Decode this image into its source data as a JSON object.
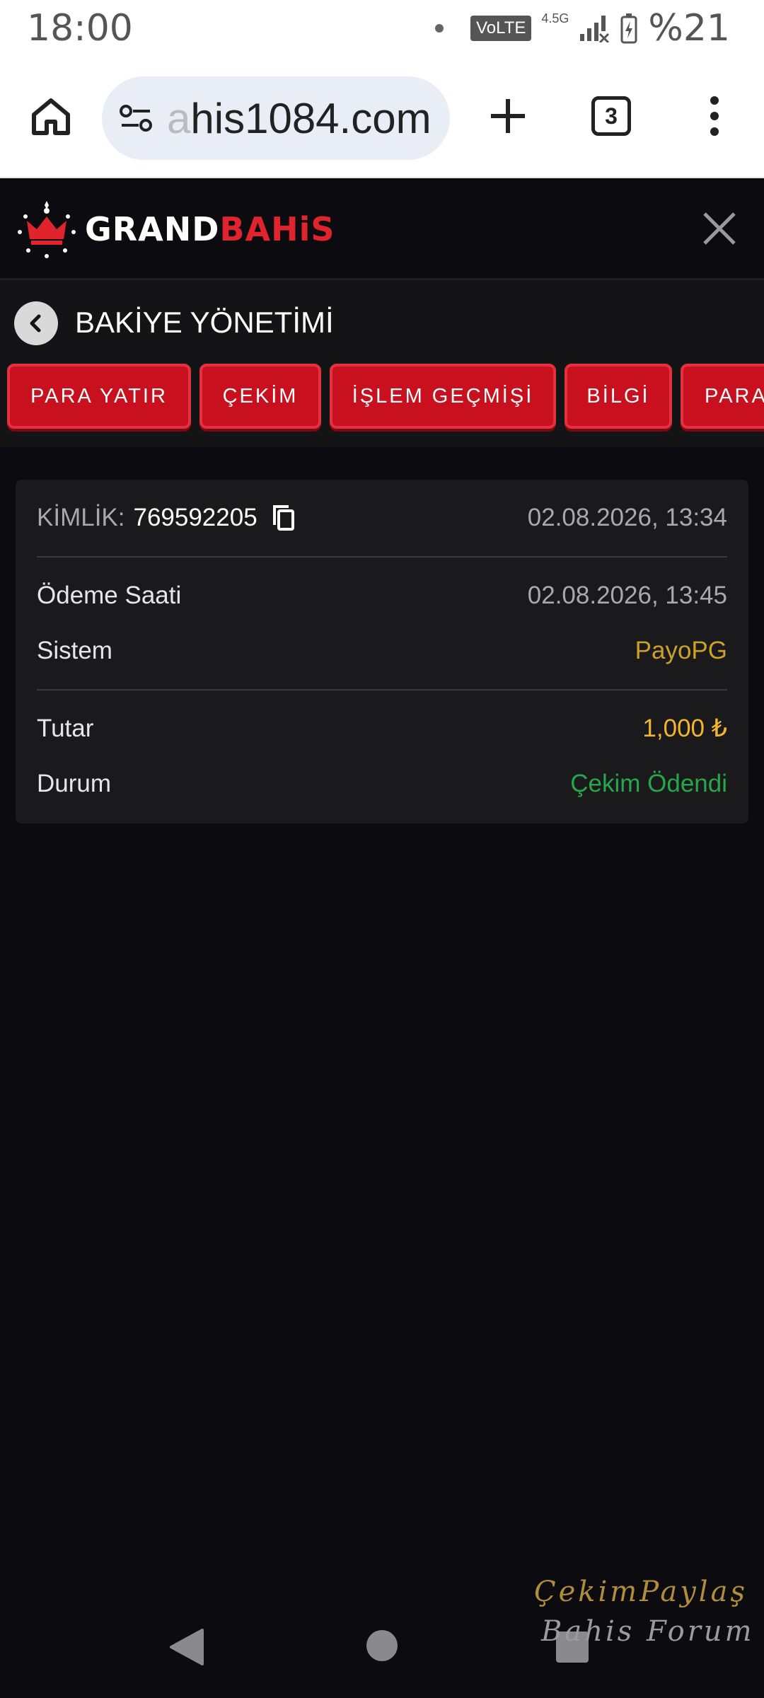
{
  "status": {
    "time": "18:00",
    "volte": "VoLTE",
    "network": "4.5G",
    "battery": "%21"
  },
  "browser": {
    "url_faded": "a",
    "url": "his1084.com",
    "tab_count": "3"
  },
  "header": {
    "logo_grand": "GRAND",
    "logo_bahis": "BAHiS"
  },
  "page": {
    "title": "BAKİYE YÖNETİMİ",
    "tabs": [
      {
        "label": "PARA YATIR"
      },
      {
        "label": "ÇEKİM"
      },
      {
        "label": "İŞLEM GEÇMİŞİ"
      },
      {
        "label": "BİLGİ"
      },
      {
        "label": "PARA"
      }
    ]
  },
  "transaction": {
    "id_label": "KİMLİK:",
    "id_value": "769592205",
    "created": "02.08.2026, 13:34",
    "payment_time_label": "Ödeme Saati",
    "payment_time_value": "02.08.2026, 13:45",
    "system_label": "Sistem",
    "system_value": "PayoPG",
    "amount_label": "Tutar",
    "amount_value": "1,000 ₺",
    "status_label": "Durum",
    "status_value": "Çekim Ödendi"
  },
  "watermark": {
    "line1": "ÇekimPaylaş",
    "line2": "Bahis Forum"
  },
  "colors": {
    "brand_red": "#c8101e",
    "amount": "#f3b52a",
    "system": "#c9a227",
    "status_paid": "#27a64a",
    "background": "#0c0c10"
  }
}
